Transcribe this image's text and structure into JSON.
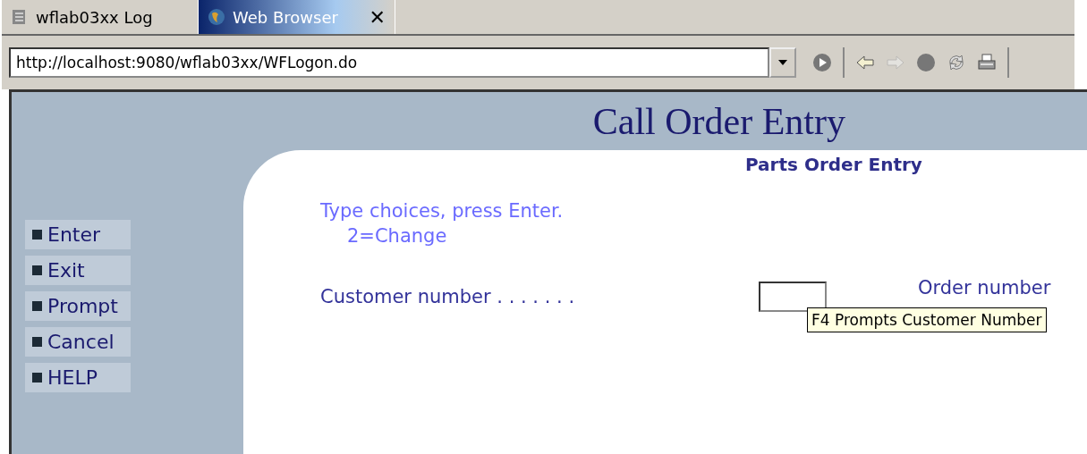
{
  "tabs": [
    {
      "label": "wflab03xx Log",
      "kind": "log",
      "selected": false
    },
    {
      "label": "Web Browser",
      "kind": "browser",
      "selected": true,
      "close": "✕"
    }
  ],
  "address_bar": {
    "value": "http://localhost:9080/wflab03xx/WFLogon.do"
  },
  "toolbar": [
    {
      "kind": "go",
      "disabled": false
    },
    {
      "kind": "separator"
    },
    {
      "kind": "back",
      "disabled": false
    },
    {
      "kind": "forward",
      "disabled": true
    },
    {
      "kind": "stop",
      "disabled": false
    },
    {
      "kind": "refresh",
      "disabled": false
    },
    {
      "kind": "print",
      "disabled": false
    },
    {
      "kind": "separator"
    }
  ],
  "page": {
    "title": "Call Order Entry",
    "subtitle": "Parts Order Entry",
    "instructions": [
      "Type choices, press Enter.",
      "2=Change"
    ],
    "function_keys": [
      "Enter",
      "Exit",
      "Prompt",
      "Cancel",
      "HELP"
    ],
    "fields": [
      {
        "label": "Customer number . . . . . . ."
      }
    ],
    "field_2_label": "Order number",
    "tooltip": "F4 Prompts Customer Number"
  }
}
